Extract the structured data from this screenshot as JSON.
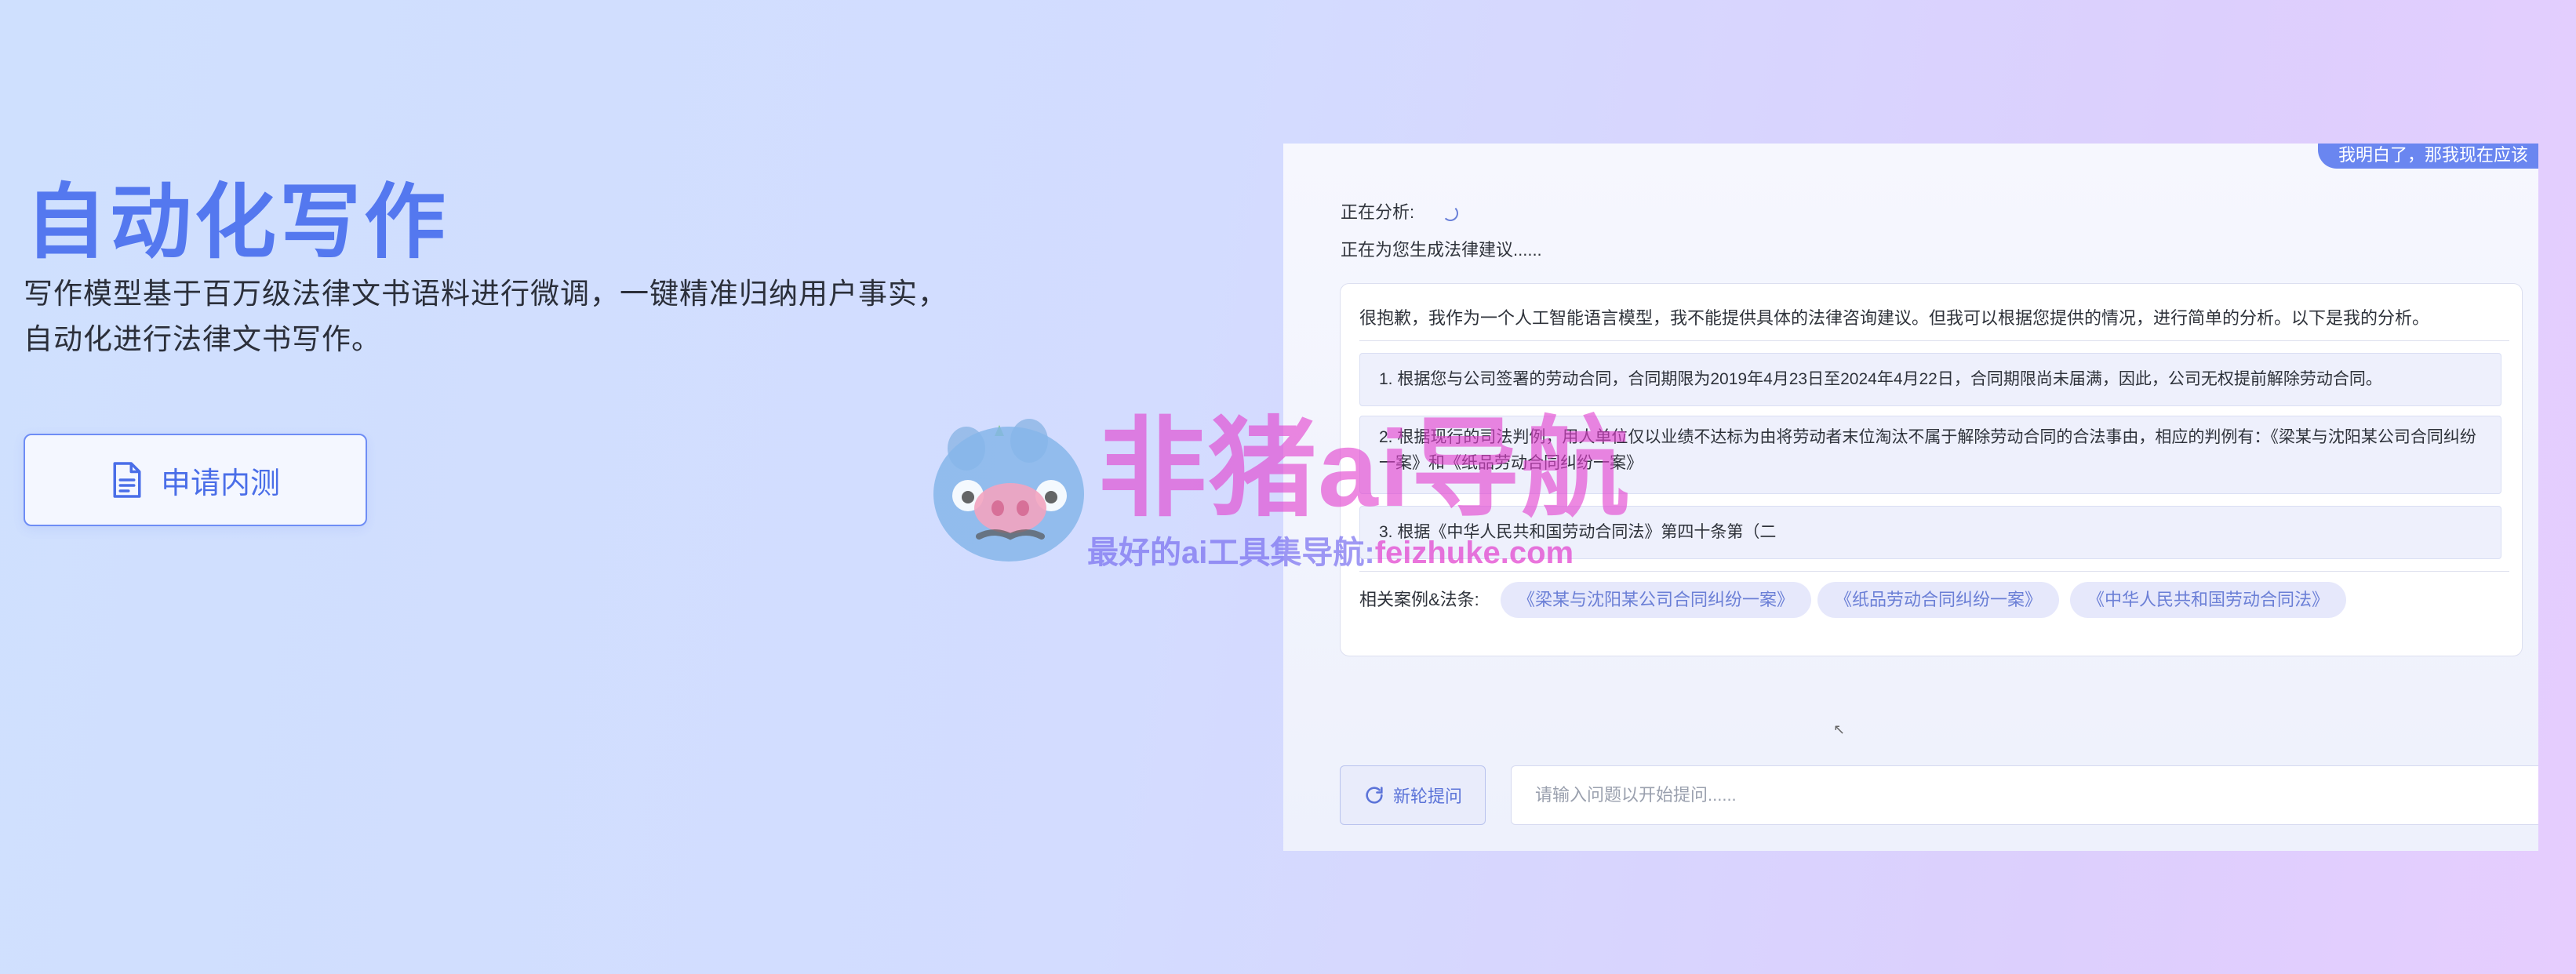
{
  "hero": {
    "title": "自动化写作",
    "description_line1": "写作模型基于百万级法律文书语料进行微调，一键精准归纳用户事实，",
    "description_line2": "自动化进行法律文书写作。",
    "apply_button": "申请内测"
  },
  "demo": {
    "user_bubble": "我明白了，那我现在应该",
    "status_analyzing": "正在分析:",
    "status_generating": "正在为您生成法律建议......",
    "answer": {
      "intro": "很抱歉，我作为一个人工智能语言模型，我不能提供具体的法律咨询建议。但我可以根据您提供的情况，进行简单的分析。以下是我的分析。",
      "points": [
        "1. 根据您与公司签署的劳动合同，合同期限为2019年4月23日至2024年4月22日，合同期限尚未届满，因此，公司无权提前解除劳动合同。",
        "2. 根据现行的司法判例，用人单位仅以业绩不达标为由将劳动者末位淘汰不属于解除劳动合同的合法事由，相应的判例有：《梁某与沈阳某公司合同纠纷一案》和《纸品劳动合同纠纷一案》",
        "3. 根据《中华人民共和国劳动合同法》第四十条第（二"
      ],
      "related_label": "相关案例&法条:",
      "related_tags": [
        "《梁某与沈阳某公司合同纠纷一案》",
        "《纸品劳动合同纠纷一案》",
        "《中华人民共和国劳动合同法》"
      ]
    },
    "new_question_button": "新轮提问",
    "input_placeholder": "请输入问题以开始提问......"
  },
  "watermark": {
    "main": "非猪ai导航",
    "sub_prefix": "最好的ai工具集导航:",
    "sub_site": "feizhuke.com"
  },
  "colors": {
    "accent": "#5478ef",
    "watermark_pink": "#e240ce",
    "tag_text": "#6b7fd6"
  },
  "icons": {
    "apply": "document-icon",
    "refresh": "refresh-icon",
    "loading": "spinner-icon",
    "pointer": "mouse-cursor-icon"
  }
}
